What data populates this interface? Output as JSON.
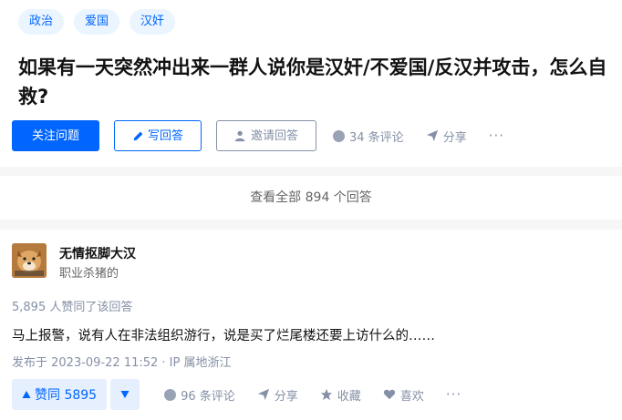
{
  "question": {
    "tags": [
      "政治",
      "爱国",
      "汉奸"
    ],
    "title": "如果有一天突然冲出来一群人说你是汉奸/不爱国/反汉并攻击，怎么自救?",
    "follow_label": "关注问题",
    "write_answer_label": "写回答",
    "invite_label": "邀请回答",
    "comments_label": "34 条评论",
    "share_label": "分享",
    "more_label": "···"
  },
  "view_all_label": "查看全部 894 个回答",
  "answer": {
    "author_name": "无情抠脚大汉",
    "author_bio": "职业杀猪的",
    "vote_info": "5,895 人赞同了该回答",
    "content": "马上报警，说有人在非法组织游行，说是买了烂尾楼还要上访什么的……",
    "time": "发布于 2023-09-22 11:52 · IP 属地浙江",
    "upvote_label": "赞同 5895",
    "comments_label": "96 条评论",
    "share_label": "分享",
    "favorite_label": "收藏",
    "like_label": "喜欢",
    "more_label": "···"
  },
  "colors": {
    "brand_blue": "#0066ff",
    "tag_bg": "#ebf5ff",
    "muted_gray": "#8590a6"
  },
  "icons": {
    "write": "pencil-icon",
    "invite": "person-plus-icon",
    "comment": "comment-bubble-icon",
    "share": "paper-plane-icon",
    "upvote": "triangle-up-icon",
    "downvote": "triangle-down-icon",
    "favorite": "star-icon",
    "like": "heart-icon"
  }
}
